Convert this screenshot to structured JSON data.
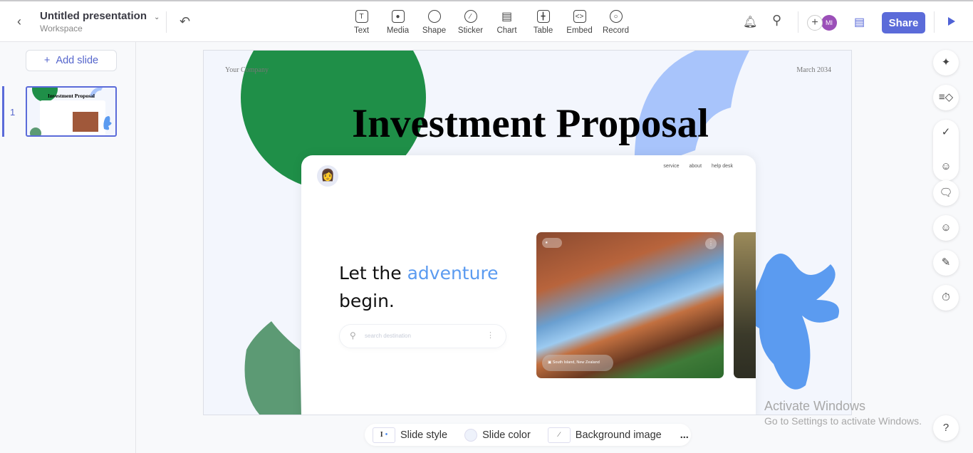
{
  "header": {
    "title": "Untitled presentation",
    "subtitle": "Workspace",
    "tools": [
      {
        "label": "Text",
        "icon": "text-icon"
      },
      {
        "label": "Media",
        "icon": "media-icon"
      },
      {
        "label": "Shape",
        "icon": "shape-icon"
      },
      {
        "label": "Sticker",
        "icon": "sticker-icon"
      },
      {
        "label": "Chart",
        "icon": "chart-icon"
      },
      {
        "label": "Table",
        "icon": "table-icon"
      },
      {
        "label": "Embed",
        "icon": "embed-icon"
      },
      {
        "label": "Record",
        "icon": "record-icon"
      }
    ],
    "avatar_initials": "MI",
    "share_label": "Share",
    "accent": "#5b6bd9"
  },
  "sidebar": {
    "add_slide": "Add slide",
    "slides": [
      {
        "number": "1",
        "title": "Investment Proposal"
      }
    ]
  },
  "slide": {
    "company": "Your Company",
    "date": "March 2034",
    "title": "Investment Proposal",
    "mockup": {
      "nav": [
        "service",
        "about",
        "help desk"
      ],
      "hero_prefix": "Let the ",
      "hero_highlight": "adventure",
      "hero_suffix": "begin.",
      "search_placeholder": "search destination",
      "location": "South Island, New Zealand"
    },
    "colors": {
      "green": "#1f8f48",
      "blue": "#5b9bf0",
      "light_blue": "#a8c4fb",
      "sage": "#5c9a74"
    }
  },
  "bottom_bar": {
    "slide_style": "Slide style",
    "slide_color": "Slide color",
    "background_image": "Background image",
    "more": "..."
  },
  "watermark": {
    "line1": "Activate Windows",
    "line2": "Go to Settings to activate Windows."
  }
}
